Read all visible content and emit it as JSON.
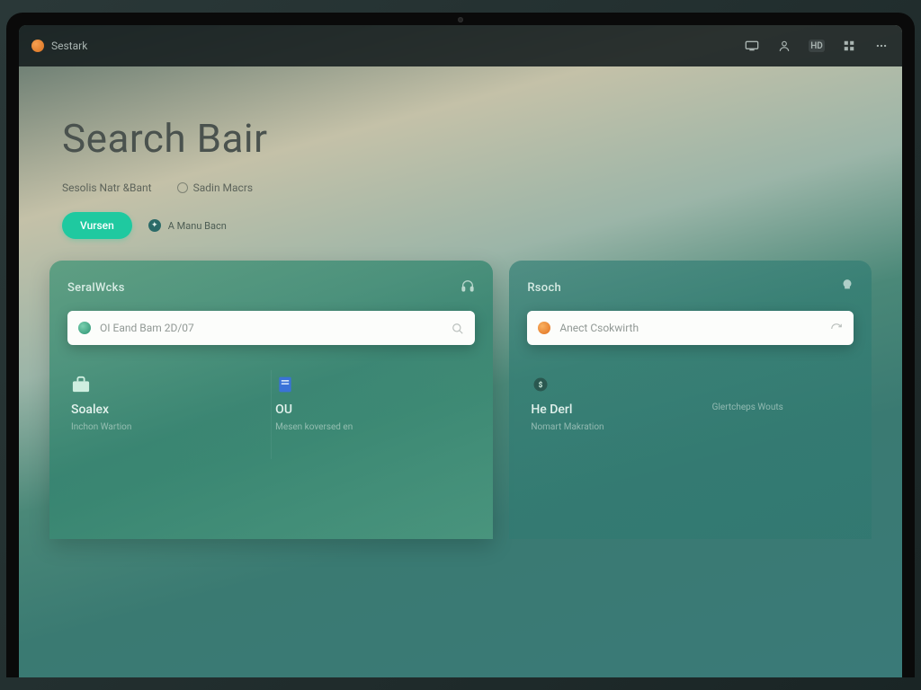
{
  "topbar": {
    "brand": "Sestark",
    "icons": [
      "device",
      "user",
      "badge",
      "grid",
      "menu"
    ]
  },
  "hero": {
    "title": "Search Bair",
    "sub1": "Sesolis Natr &Bant",
    "sub2": "Sadin Macrs",
    "primary_label": "Vursen",
    "secondary_label": "A Manu Bacn"
  },
  "panels": {
    "left": {
      "title": "SeralWcks",
      "search_placeholder": "OI Eand Bam 2D/07",
      "tiles": [
        {
          "title": "Soalex",
          "sub": "Inchon Wartion"
        },
        {
          "title": "OU",
          "sub": "Mesen koversed en"
        }
      ]
    },
    "right": {
      "title": "Rsoch",
      "search_placeholder": "Anect Csokwirth",
      "tiles": [
        {
          "title": "He Derl",
          "sub": "Nomart Makration"
        },
        {
          "title": "",
          "sub": "Glertcheps Wouts"
        }
      ]
    }
  }
}
